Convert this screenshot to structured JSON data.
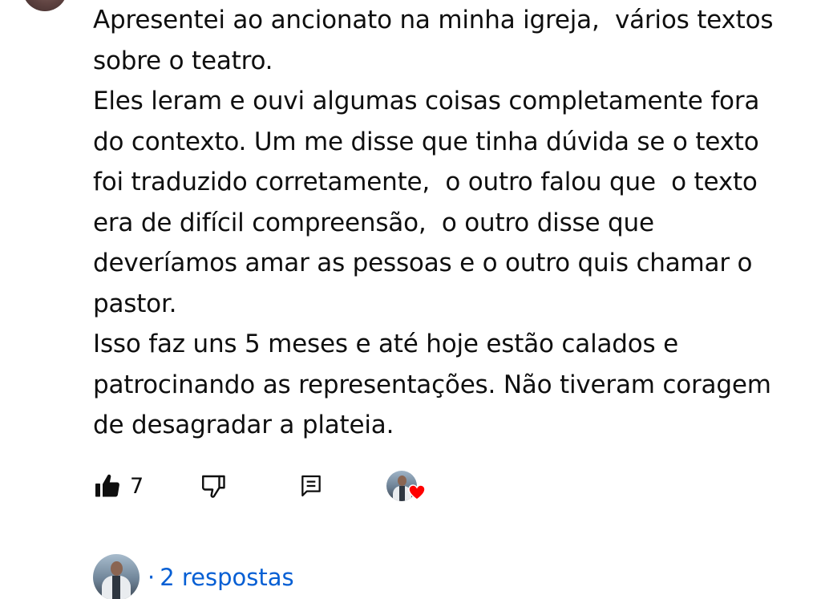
{
  "comment": {
    "paragraphs": [
      "Apresentei ao ancionato na minha igreja,  vários textos\nsobre o teatro.",
      "Eles leram e ouvi algumas coisas completamente fora\ndo contexto. Um me disse que tinha dúvida se o texto\nfoi traduzido corretamente,  o outro falou que  o texto\nera de difícil compreensão,  o outro disse que\ndeveríamos amar as pessoas e o outro quis chamar o\npastor.",
      "Isso faz uns 5 meses e até hoje estão calados e\npatrocinando as representações. Não tiveram coragem\nde desagradar a plateia."
    ]
  },
  "actions": {
    "like_icon": "thumb-up-filled-icon",
    "like_count": "7",
    "dislike_icon": "thumb-down-outline-icon",
    "reply_icon": "comment-reply-icon",
    "creator_heart_icon": "heart-icon",
    "heart_color": "#ff0000"
  },
  "replies": {
    "dot": "·",
    "label": "2 respostas",
    "link_color": "#065fd4"
  }
}
